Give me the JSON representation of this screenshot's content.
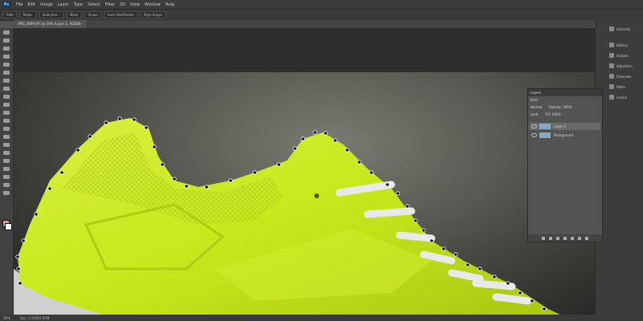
{
  "app": {
    "logo": "Ps"
  },
  "menu": [
    "File",
    "Edit",
    "Image",
    "Layer",
    "Type",
    "Select",
    "Filter",
    "3D",
    "View",
    "Window",
    "Help"
  ],
  "options": [
    "Path",
    "Make:",
    "Selection...",
    "Mask",
    "Shape",
    "Auto Add/Delete",
    "Align Edges"
  ],
  "document": {
    "tab_label": "IMG_4699.JPG @ 50% (Layer 1, RGB/8)"
  },
  "right_panels": [
    "Libraries",
    "History",
    "Actions",
    "Adjustme...",
    "Channels",
    "Paths",
    "Layers"
  ],
  "layers_panel": {
    "title": "Layers",
    "kind": "Kind",
    "blend": "Normal",
    "opacity": "Opacity: 100%",
    "lock": "Lock:",
    "fill": "Fill: 100%",
    "layers": [
      {
        "name": "Layer 1",
        "selected": true
      },
      {
        "name": "Background",
        "selected": false
      }
    ]
  },
  "status": {
    "zoom": "50%",
    "doc": "Doc: 1.51M/2.95M"
  },
  "colors": {
    "shoe": "#c8e81c",
    "anchor": "#111111"
  }
}
